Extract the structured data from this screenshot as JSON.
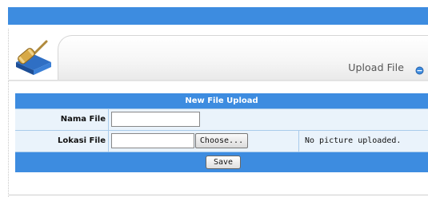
{
  "header": {
    "title": "Upload File",
    "accent": "#3d8ce0"
  },
  "icons": {
    "logo": "gavel-icon",
    "title_bullet": "blue-circle-bullet-icon"
  },
  "form": {
    "heading": "New File Upload",
    "nama_file_label": "Nama File",
    "nama_file_value": "",
    "lokasi_file_label": "Lokasi File",
    "choose_label": "Choose...",
    "no_picture_text": "No picture uploaded.",
    "save_label": "Save"
  }
}
